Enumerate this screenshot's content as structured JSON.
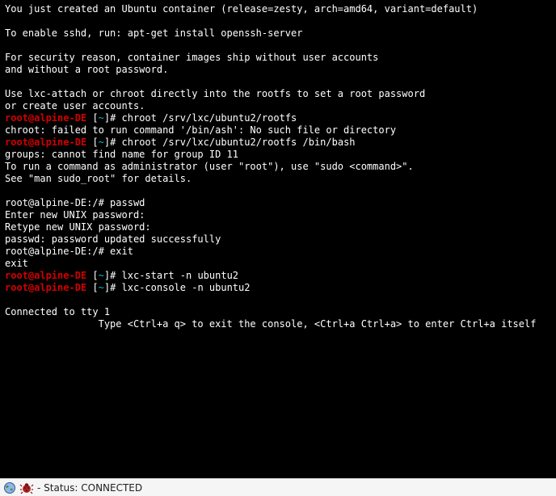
{
  "terminal": {
    "lines": [
      {
        "type": "plain",
        "text": "You just created an Ubuntu container (release=zesty, arch=amd64, variant=default)"
      },
      {
        "type": "blank"
      },
      {
        "type": "plain",
        "text": "To enable sshd, run: apt-get install openssh-server"
      },
      {
        "type": "blank"
      },
      {
        "type": "plain",
        "text": "For security reason, container images ship without user accounts"
      },
      {
        "type": "plain",
        "text": "and without a root password."
      },
      {
        "type": "blank"
      },
      {
        "type": "plain",
        "text": "Use lxc-attach or chroot directly into the rootfs to set a root password"
      },
      {
        "type": "plain",
        "text": "or create user accounts."
      },
      {
        "type": "prompt",
        "user": "root@alpine-DE",
        "bracket_open": " [",
        "tilde": "~",
        "bracket_close": "]# ",
        "cmd": "chroot /srv/lxc/ubuntu2/rootfs"
      },
      {
        "type": "plain",
        "text": "chroot: failed to run command '/bin/ash': No such file or directory"
      },
      {
        "type": "prompt",
        "user": "root@alpine-DE",
        "bracket_open": " [",
        "tilde": "~",
        "bracket_close": "]# ",
        "cmd": "chroot /srv/lxc/ubuntu2/rootfs /bin/bash"
      },
      {
        "type": "plain",
        "text": "groups: cannot find name for group ID 11"
      },
      {
        "type": "plain",
        "text": "To run a command as administrator (user \"root\"), use \"sudo <command>\"."
      },
      {
        "type": "plain",
        "text": "See \"man sudo_root\" for details."
      },
      {
        "type": "blank"
      },
      {
        "type": "plain",
        "text": "root@alpine-DE:/# passwd"
      },
      {
        "type": "plain",
        "text": "Enter new UNIX password:"
      },
      {
        "type": "plain",
        "text": "Retype new UNIX password:"
      },
      {
        "type": "plain",
        "text": "passwd: password updated successfully"
      },
      {
        "type": "plain",
        "text": "root@alpine-DE:/# exit"
      },
      {
        "type": "plain",
        "text": "exit"
      },
      {
        "type": "prompt",
        "user": "root@alpine-DE",
        "bracket_open": " [",
        "tilde": "~",
        "bracket_close": "]# ",
        "cmd": "lxc-start -n ubuntu2"
      },
      {
        "type": "prompt",
        "user": "root@alpine-DE",
        "bracket_open": " [",
        "tilde": "~",
        "bracket_close": "]# ",
        "cmd": "lxc-console -n ubuntu2"
      },
      {
        "type": "blank"
      },
      {
        "type": "plain",
        "text": "Connected to tty 1"
      },
      {
        "type": "plain",
        "text": "                Type <Ctrl+a q> to exit the console, <Ctrl+a Ctrl+a> to enter Ctrl+a itself"
      }
    ]
  },
  "status": {
    "text": " - Status: CONNECTED"
  },
  "icons": {
    "globe": "globe-icon",
    "bug": "bug-icon"
  }
}
